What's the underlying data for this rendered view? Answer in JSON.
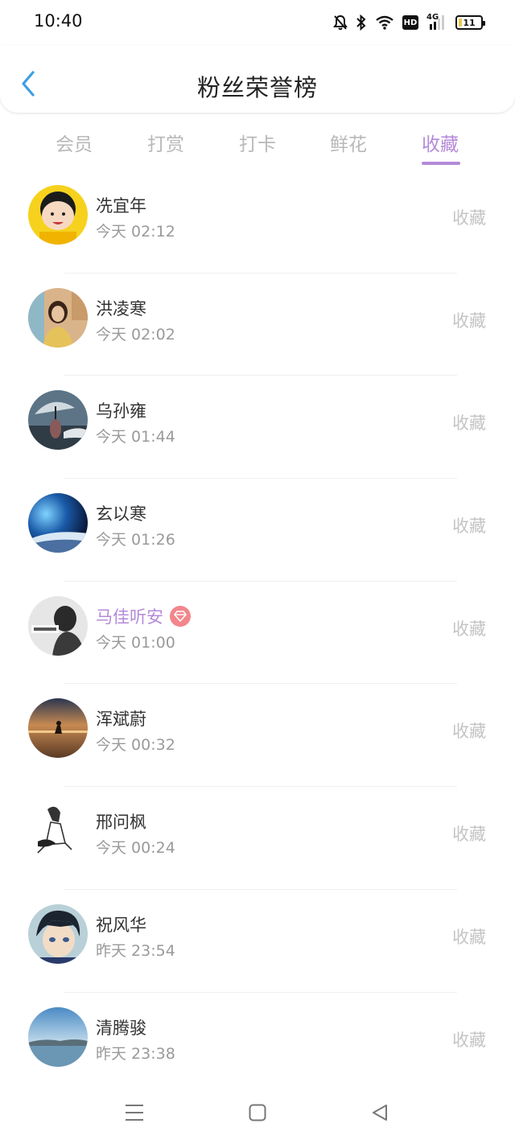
{
  "status": {
    "time": "10:40",
    "hd": "HD",
    "network": "4G",
    "battery": "11"
  },
  "header": {
    "title": "粉丝荣誉榜"
  },
  "tabs": [
    {
      "label": "会员",
      "active": false
    },
    {
      "label": "打赏",
      "active": false
    },
    {
      "label": "打卡",
      "active": false
    },
    {
      "label": "鲜花",
      "active": false
    },
    {
      "label": "收藏",
      "active": true
    }
  ],
  "fans": [
    {
      "name": "冼宜年",
      "time": "今天 02:12",
      "action": "收藏",
      "vip": false,
      "avatar": "cartoon-girl-yellow"
    },
    {
      "name": "洪凌寒",
      "time": "今天 02:02",
      "action": "收藏",
      "vip": false,
      "avatar": "woman-photo"
    },
    {
      "name": "乌孙雍",
      "time": "今天 01:44",
      "action": "收藏",
      "vip": false,
      "avatar": "umbrella-rain"
    },
    {
      "name": "玄以寒",
      "time": "今天 01:26",
      "action": "收藏",
      "vip": false,
      "avatar": "earth-space"
    },
    {
      "name": "马佳听安",
      "time": "今天 01:00",
      "action": "收藏",
      "vip": true,
      "avatar": "bw-portrait"
    },
    {
      "name": "浑斌蔚",
      "time": "今天 00:32",
      "action": "收藏",
      "vip": false,
      "avatar": "sunset-figure"
    },
    {
      "name": "邢问枫",
      "time": "今天 00:24",
      "action": "收藏",
      "vip": false,
      "avatar": "sketch-figure"
    },
    {
      "name": "祝风华",
      "time": "昨天 23:54",
      "action": "收藏",
      "vip": false,
      "avatar": "anime-boy"
    },
    {
      "name": "清腾骏",
      "time": "昨天 23:38",
      "action": "收藏",
      "vip": false,
      "avatar": "lake-landscape"
    }
  ],
  "colors": {
    "accent": "#b48ad8",
    "muted": "#c4c4c4",
    "back": "#3b9fe6",
    "vip_badge": "#f2868c"
  }
}
